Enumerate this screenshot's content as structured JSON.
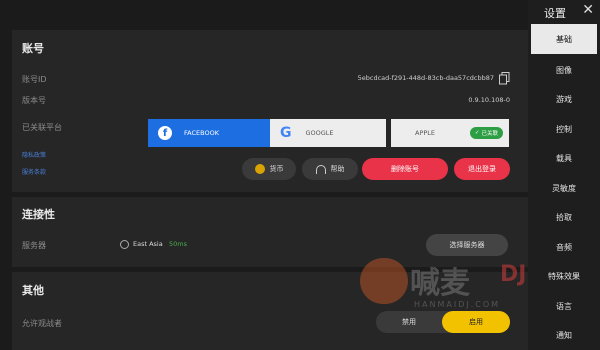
{
  "title": "设置",
  "account": {
    "heading": "账号",
    "id_label": "账号ID",
    "id_value": "5ebcdcad-f291-448d-83cb-daa57cdcbb87",
    "version_label": "版本号",
    "version_value": "0.9.10.108-0",
    "linked_label": "已关联平台",
    "privacy_link": "隐私政策",
    "terms_link": "服务条款",
    "platforms": {
      "facebook": "FACEBOOK",
      "google": "GOOGLE",
      "apple": "APPLE",
      "apple_status": "已关联"
    },
    "actions": {
      "currency": "货币",
      "help": "帮助",
      "delete": "删除账号",
      "logout": "退出登录"
    }
  },
  "connectivity": {
    "heading": "连接性",
    "server_label": "服务器",
    "server_name": "East Asia",
    "ping": "50ms",
    "select_server": "选择服务器"
  },
  "other": {
    "heading": "其他",
    "allow_spectators_label": "允许观战者",
    "toggle_off": "禁用",
    "toggle_on": "启用"
  },
  "sidebar": {
    "items": [
      {
        "label": "基础"
      },
      {
        "label": "图像"
      },
      {
        "label": "游戏"
      },
      {
        "label": "控制"
      },
      {
        "label": "载具"
      },
      {
        "label": "灵敏度"
      },
      {
        "label": "拾取"
      },
      {
        "label": "音频"
      },
      {
        "label": "特殊效果"
      },
      {
        "label": "语言"
      },
      {
        "label": "通知"
      }
    ]
  },
  "watermark": {
    "cn": "喊麦",
    "en": "HANMAIDJ.COM"
  },
  "colors": {
    "facebook": "#1d6ee0",
    "danger": "#e83348",
    "accent": "#f2c200",
    "ping": "#4caf50",
    "linked_badge": "#2e9e44"
  }
}
